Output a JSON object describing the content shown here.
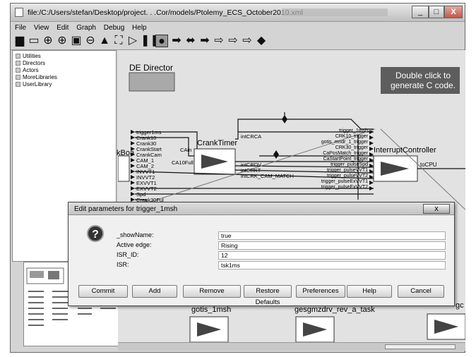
{
  "window": {
    "title": "file:/C:/Users/stefan/Desktop/project. . .Cor/models/Ptolemy_ECS_October2010.xml",
    "minimize": "_",
    "maximize": "□",
    "close": "X"
  },
  "menubar": {
    "items": [
      "File",
      "View",
      "Edit",
      "Graph",
      "Debug",
      "Help"
    ]
  },
  "toolbar": {
    "icons": [
      "save-icon",
      "print-icon",
      "zoom-in-icon",
      "zoom-reset-icon",
      "zoom-fit-icon",
      "zoom-out-icon",
      "stop-triangle-icon",
      "fullscreen-icon",
      "run-icon",
      "pause-icon",
      "stop-icon",
      "arrow-right-icon",
      "flag-icon",
      "arrow-left-icon",
      "bidirectional-icon",
      "diamond-icon"
    ]
  },
  "sidebar": {
    "items": [
      "Utilities",
      "Directors",
      "Actors",
      "MoreLibraries",
      "UserLibrary"
    ]
  },
  "canvas": {
    "director_label": "DE Director",
    "note_text": "Double click to generate C code.",
    "crank_timer_label": "CrankTimer",
    "interrupt_controller_label": "InterruptController",
    "left_fragment": "kBoa",
    "in_ports": [
      "trigger1ms",
      "Crank10",
      "Crank30",
      "CrankStart",
      "CrankCam",
      "CAM_1",
      "CAM_2",
      "INVVT1",
      "INVVT2",
      "EXVVT1",
      "EXVVT2",
      "Spd",
      "Crank30Ful"
    ],
    "crank_ports": [
      "CAin",
      "CA10Full"
    ],
    "crank_out_ports": [
      "intCRCA",
      "intCRDV",
      "intCRKT",
      "intCRK_CAM_MATCH"
    ],
    "ic_in_ports": [
      "trigger_1msh",
      "CRK10_trigger",
      "gotis_mndr_1_trigger",
      "CRK30_trigger",
      "CaPosMatch_trigger",
      "CaStartPoint_trigger",
      "trigger_pulseSpd",
      "trigger_pulseVVT1",
      "trigger_pulseVVT2",
      "trigger_pulseExVVT1",
      "trigger_pulseExVVT2"
    ],
    "ic_out": "toCPU",
    "bottom_labels": [
      "gotis_1msh",
      "gesgmzdrv_rev_a_task",
      "gc"
    ]
  },
  "dialog": {
    "title": "Edit parameters for trigger_1msh",
    "close": "x",
    "fields": [
      {
        "label": "_showName:",
        "value": "true"
      },
      {
        "label": "Active edge:",
        "value": "Rising"
      },
      {
        "label": "ISR_ID:",
        "value": "12"
      },
      {
        "label": "ISR:",
        "value": "tsk1ms"
      }
    ],
    "buttons": [
      "Commit",
      "Add",
      "Remove",
      "Restore Defaults",
      "Preferences",
      "Help",
      "Cancel"
    ]
  },
  "colors": {
    "note_bg": "#5d5d5d",
    "director_box": "#a9a9a9",
    "canvas_bg": "#e2e2e2"
  }
}
